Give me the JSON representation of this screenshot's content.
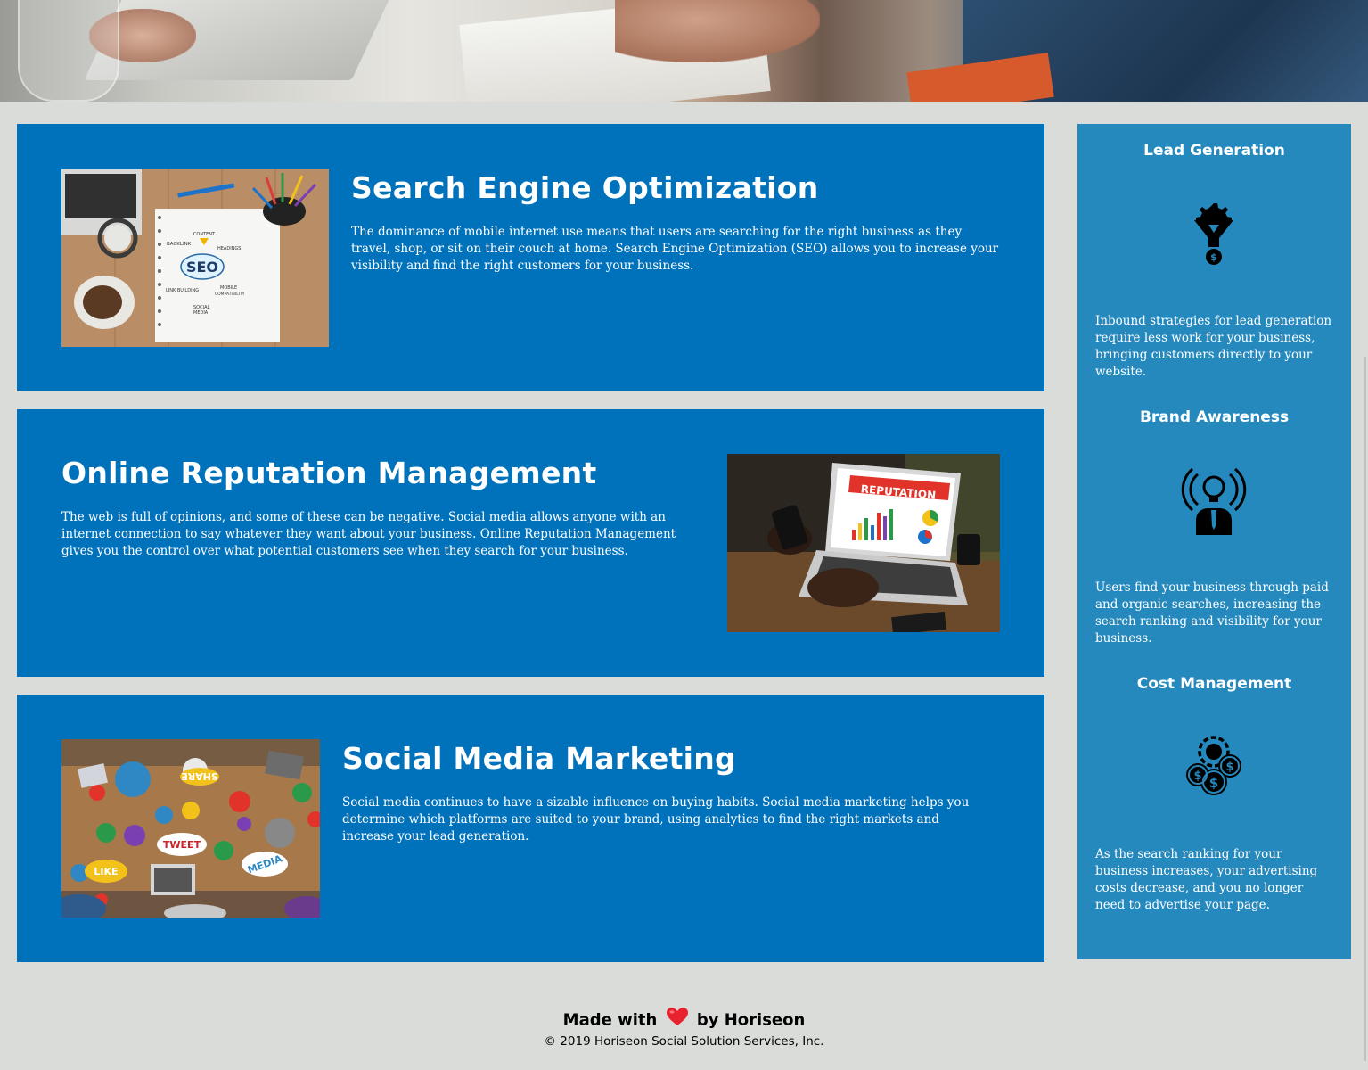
{
  "cards": [
    {
      "title": "Search Engine Optimization",
      "body": "The dominance of mobile internet use means that users are searching for the right business as they travel, shop, or sit on their couch at home. Search Engine Optimization (SEO) allows you to increase your visibility and find the right customers for your business.",
      "image_icon": "seo-notebook-image",
      "image_text": {
        "content": "CONTENT",
        "backlink": "BACKLINK",
        "headings": "HEADINGS",
        "seo": "SEO",
        "link_building": "LINK BUILDING",
        "mobile": "MOBILE",
        "compat": "COMPATIBILITY",
        "social": "SOCIAL",
        "media": "MEDIA"
      }
    },
    {
      "title": "Online Reputation Management",
      "body": "The web is full of opinions, and some of these can be negative. Social media allows anyone with an internet connection to say whatever they want about your business. Online Reputation Management gives you the control over what potential customers see when they search for your business.",
      "image_icon": "reputation-laptop-image",
      "image_text": {
        "reputation": "REPUTATION"
      }
    },
    {
      "title": "Social Media Marketing",
      "body": "Social media continues to have a sizable influence on buying habits. Social media marketing helps you determine which platforms are suited to your brand, using analytics to find the right markets and increase your lead generation.",
      "image_icon": "social-media-table-image",
      "image_text": {
        "share": "SHARE",
        "tweet": "TWEET",
        "like": "LIKE",
        "media": "MEDIA"
      }
    }
  ],
  "benefits": [
    {
      "title": "Lead Generation",
      "icon": "lead-generation-funnel-icon",
      "body": "Inbound strategies for lead generation require less work for your business, bringing customers directly to your website."
    },
    {
      "title": "Brand Awareness",
      "icon": "brand-awareness-lightbulb-icon",
      "body": "Users find your business through paid and organic searches, increasing the search ranking and visibility for your business."
    },
    {
      "title": "Cost Management",
      "icon": "cost-management-coins-icon",
      "body": "As the search ranking for your business increases, your advertising costs decrease, and you no longer need to advertise your page."
    }
  ],
  "footer": {
    "made_with": "Made with",
    "heart_icon": "heart-icon",
    "by": "by Horiseon",
    "copyright": "© 2019 Horiseon Social Solution Services, Inc."
  },
  "colors": {
    "background": "#d9dcd9",
    "card": "#0072bb",
    "sidebar": "#2589bd",
    "heart": "#e8232f"
  }
}
